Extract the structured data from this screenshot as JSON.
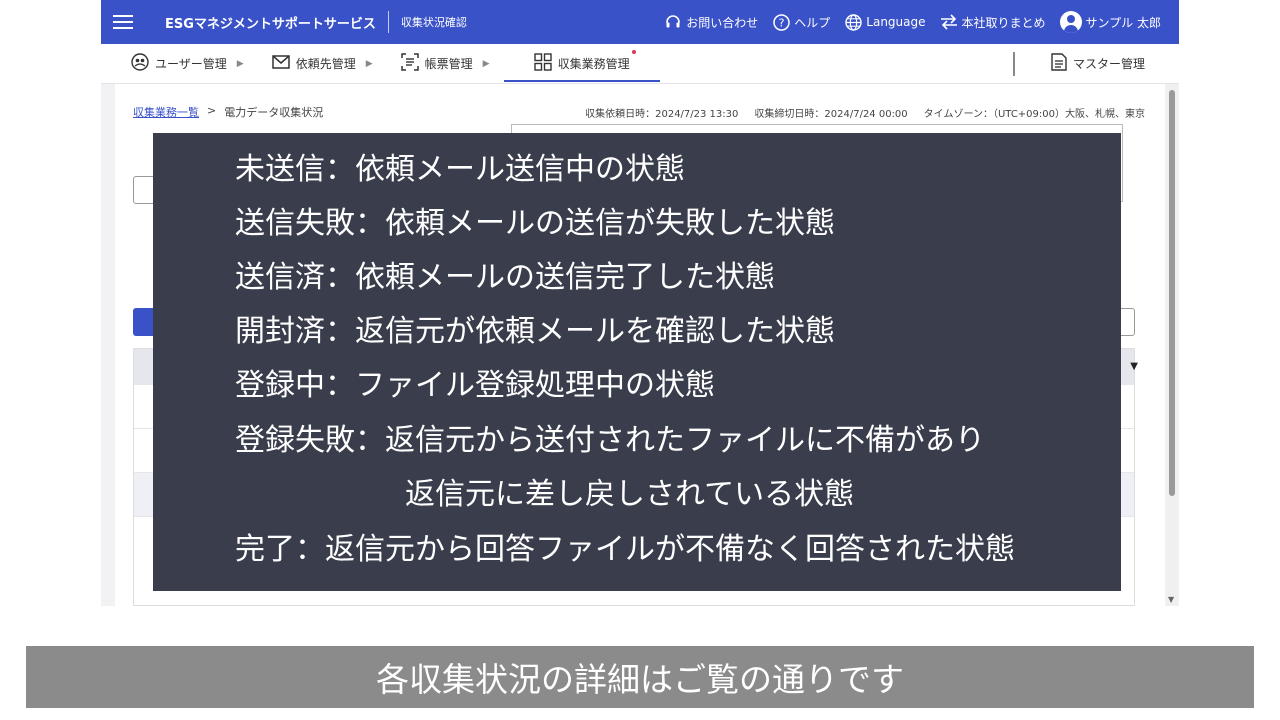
{
  "header": {
    "brand": "ESGマネジメントサポートサービス",
    "subtitle": "収集状況確認",
    "contact": "お問い合わせ",
    "help": "ヘルプ",
    "language": "Language",
    "consolidate": "本社取りまとめ",
    "user": "サンプル 太郎",
    "color": "#3a52c8"
  },
  "nav": {
    "items": [
      {
        "label": "ユーザー管理"
      },
      {
        "label": "依頼先管理"
      },
      {
        "label": "帳票管理"
      },
      {
        "label": "収集業務管理"
      }
    ],
    "master": "マスター管理"
  },
  "breadcrumb": {
    "link": "収集業務一覧",
    "current": "電力データ収集状況"
  },
  "meta": {
    "request_date": "収集依頼日時：2024/7/23 13:30",
    "deadline": "収集締切日時：2024/7/24 00:00",
    "timezone": "タイムゾーン：（UTC+09:00）大阪、札幌、東京"
  },
  "overlay": {
    "lines": [
      "未送信：依頼メール送信中の状態",
      "送信失敗：依頼メールの送信が失敗した状態",
      "送信済：依頼メールの送信完了した状態",
      "開封済：返信元が依頼メールを確認した状態",
      "登録中：ファイル登録処理中の状態",
      "登録失敗：返信元から送付されたファイルに不備があり",
      "返信元に差し戻しされている状態",
      "完了：返信元から回答ファイルが不備なく回答された状態"
    ]
  },
  "caption": "各収集状況の詳細はご覧の通りです"
}
